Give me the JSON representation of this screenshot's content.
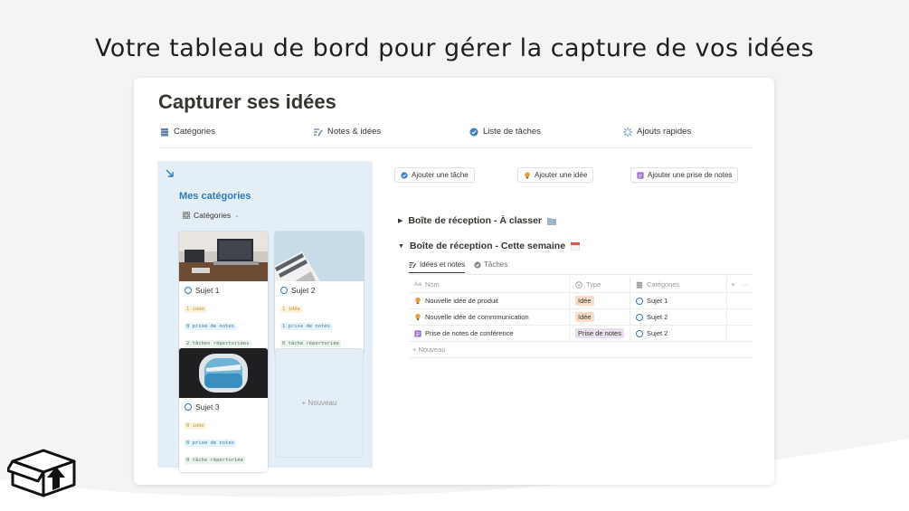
{
  "headline": "Votre tableau de bord pour gérer la capture de vos idées",
  "page": {
    "title": "Capturer ses idées",
    "nav": [
      {
        "label": "Catégories",
        "icon": "stack-icon"
      },
      {
        "label": "Notes & idées",
        "icon": "notes-icon"
      },
      {
        "label": "Liste de tâches",
        "icon": "check-circle-icon"
      },
      {
        "label": "Ajouts rapides",
        "icon": "sparkle-icon"
      }
    ]
  },
  "categories": {
    "title": "Mes catégories",
    "view_label": "Catégories",
    "cards": [
      {
        "title": "Sujet 1",
        "ideas": "1 idée",
        "notes": "0 prise de notes",
        "tasks": "2 tâches répertoriées"
      },
      {
        "title": "Sujet 2",
        "ideas": "1 idée",
        "notes": "1 prise de notes",
        "tasks": "0 tâche répertoriée"
      },
      {
        "title": "Sujet 3",
        "ideas": "0 idée",
        "notes": "0 prise de notes",
        "tasks": "0 tâche répertoriée"
      }
    ],
    "new_label": "+ Nouveau"
  },
  "actions": [
    {
      "label": "Ajouter une tâche"
    },
    {
      "label": "Ajouter une idée"
    },
    {
      "label": "Ajouter une prise de notes"
    }
  ],
  "sections": {
    "to_sort": "Boîte de réception - À classer",
    "this_week": "Boîte de réception - Cette semaine"
  },
  "view_tabs": [
    {
      "label": "Idées et notes"
    },
    {
      "label": "Tâches"
    }
  ],
  "table": {
    "headers": {
      "name": "Nom",
      "type": "Type",
      "category": "Catégories",
      "add": "+",
      "more": "···",
      "name_prefix": "Aa"
    },
    "rows": [
      {
        "name": "Nouvelle idée de produit",
        "type": "Idée",
        "category": "Sujet 1"
      },
      {
        "name": "Nouvelle idée de commmunication",
        "type": "Idée",
        "category": "Sujet 2"
      },
      {
        "name": "Prise de notes de conférence",
        "type": "Prise de notes",
        "category": "Sujet 2"
      }
    ],
    "new_label": "+ Nouveau"
  },
  "colors": {
    "accent_blue": "#2f7ab8",
    "panel_bg": "#e3eef6",
    "pill_orange": "#fadec9",
    "pill_purple": "#e8deee"
  }
}
